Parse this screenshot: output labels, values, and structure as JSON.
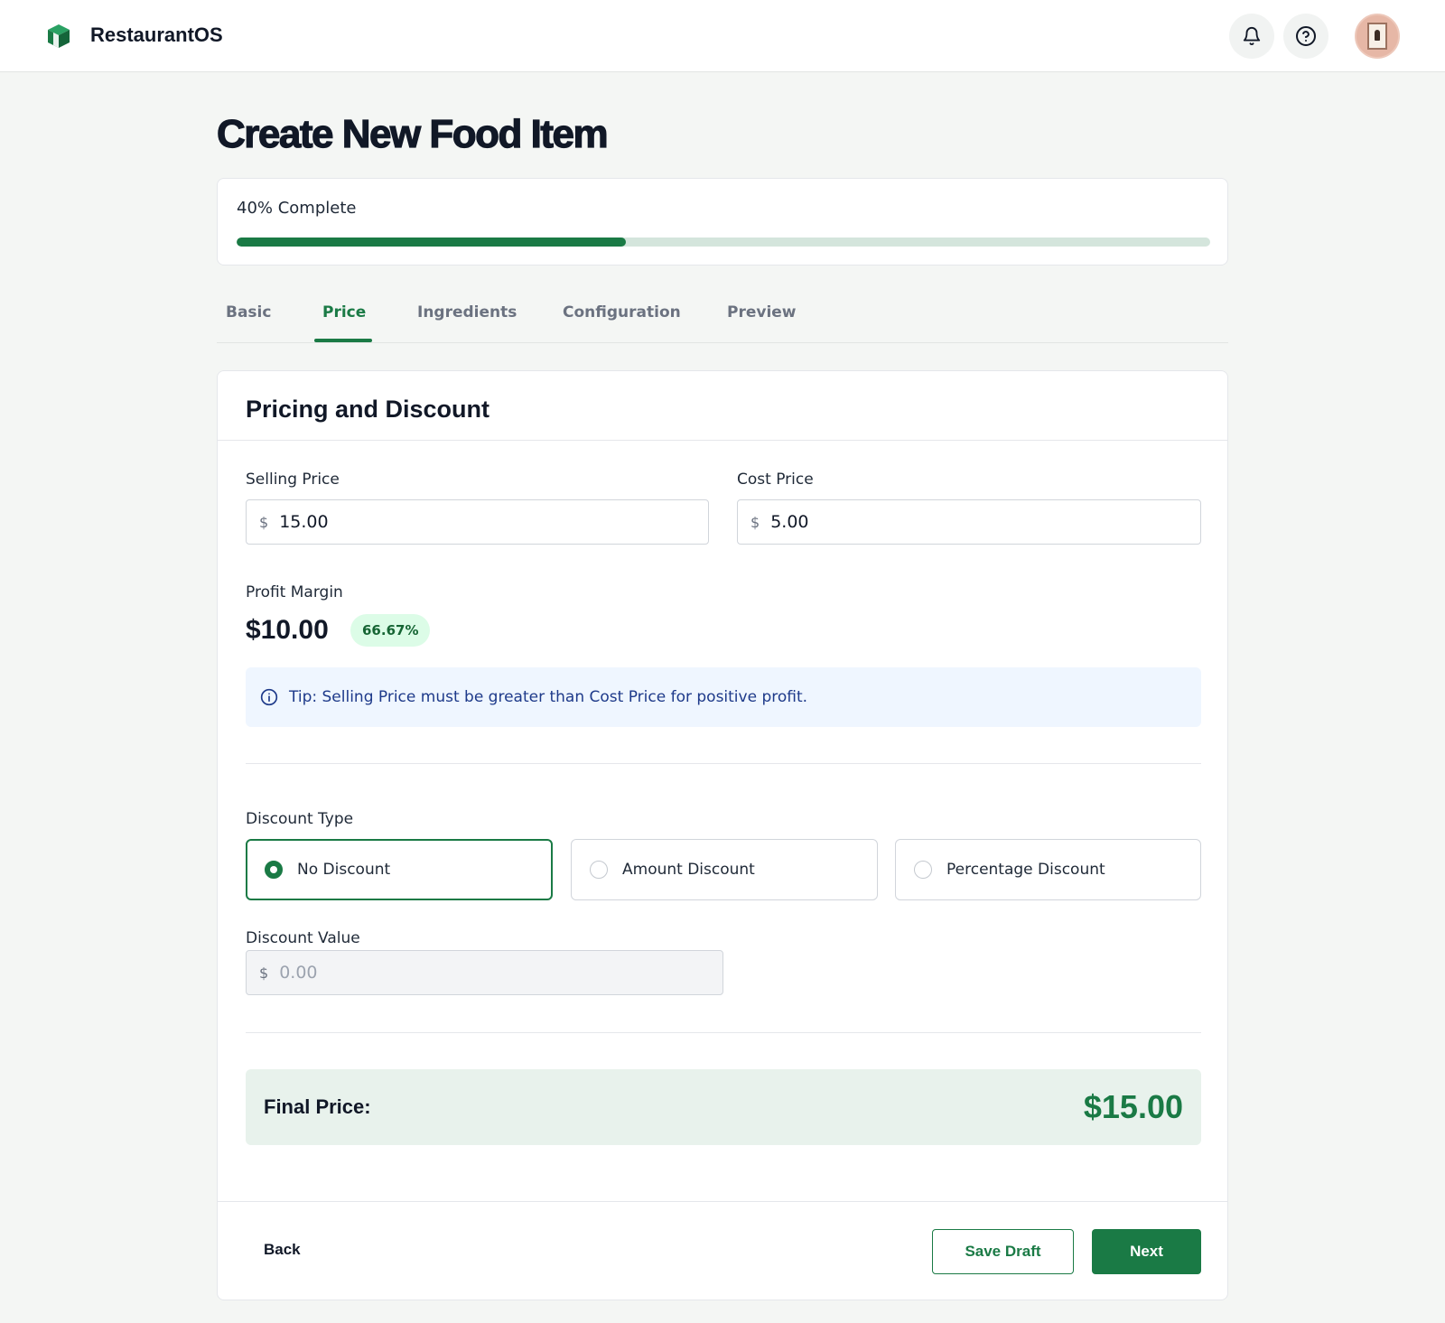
{
  "app": {
    "name": "RestaurantOS"
  },
  "header": {
    "icons": [
      "bell-icon",
      "help-icon"
    ],
    "avatar": "avatar"
  },
  "page": {
    "title": "Create New Food Item"
  },
  "progress": {
    "label": "40% Complete",
    "fraction": 0.4
  },
  "tabs": [
    {
      "label": "Basic",
      "active": false
    },
    {
      "label": "Price",
      "active": true
    },
    {
      "label": "Ingredients",
      "active": false
    },
    {
      "label": "Configuration",
      "active": false
    },
    {
      "label": "Preview",
      "active": false
    }
  ],
  "pricing": {
    "title": "Pricing and Discount",
    "selling_price": {
      "label": "Selling Price",
      "currency": "$",
      "value": "15.00"
    },
    "cost_price": {
      "label": "Cost Price",
      "currency": "$",
      "value": "5.00"
    },
    "profit_margin": {
      "label": "Profit Margin",
      "value": "$10.00",
      "percent": "66.67%"
    },
    "tip": "Tip: Selling Price must be greater than Cost Price for positive profit."
  },
  "discount": {
    "label": "Discount Type",
    "options": [
      {
        "label": "No Discount",
        "selected": true
      },
      {
        "label": "Amount Discount",
        "selected": false
      },
      {
        "label": "Percentage Discount",
        "selected": false
      }
    ],
    "value_label": "Discount Value",
    "value_currency": "$",
    "value_placeholder": "0.00"
  },
  "final_price": {
    "label": "Final Price:",
    "value": "$15.00"
  },
  "footer": {
    "back": "Back",
    "save_draft": "Save Draft",
    "next": "Next"
  },
  "colors": {
    "accent": "#1a7a45",
    "badge_bg": "#dcfce7",
    "tip_bg": "#eff6ff",
    "final_bg": "#e8f2ec"
  }
}
